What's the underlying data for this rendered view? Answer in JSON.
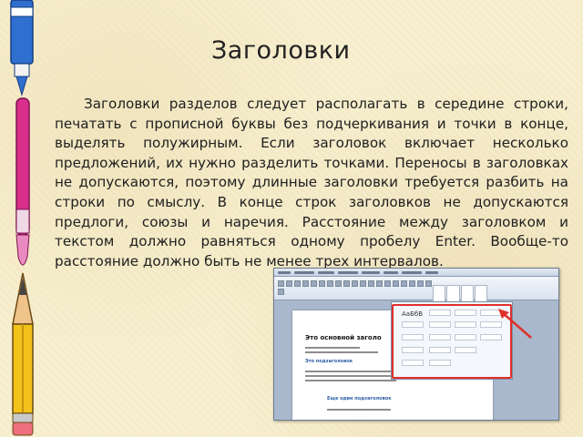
{
  "slide": {
    "title": "Заголовки",
    "body": "Заголовки разделов следует располагать в середине строки, печатать с прописной буквы без подчеркивания и точки в конце, выделять полужирным. Если заголовок включает несколько предложений, их нужно разделить точками. Переносы в заголовках не допускаются, поэтому длинные заголовки требуется разбить на строки по смыслу. В конце строк заголовков не допускаются предлоги, союзы и наречия. Расстояние между заголовком и текстом должно равняться одному пробелу Enter. Вообще-то расстояние должно быть не менее трех интервалов.",
    "visible_tail_note": "Text is partly covered by the embedded screenshot"
  },
  "screenshot": {
    "document_title": "Это основной заголо",
    "heading_1": "Это подзаголовок",
    "heading_2": "Еще один подзаголовок",
    "style_sample": "АаБбВ",
    "highlight_color": "#e0302c"
  },
  "decor": {
    "pencil_color": "#f2c21b",
    "brush_color": "#d8308a",
    "pen_color": "#2f6fd0"
  }
}
